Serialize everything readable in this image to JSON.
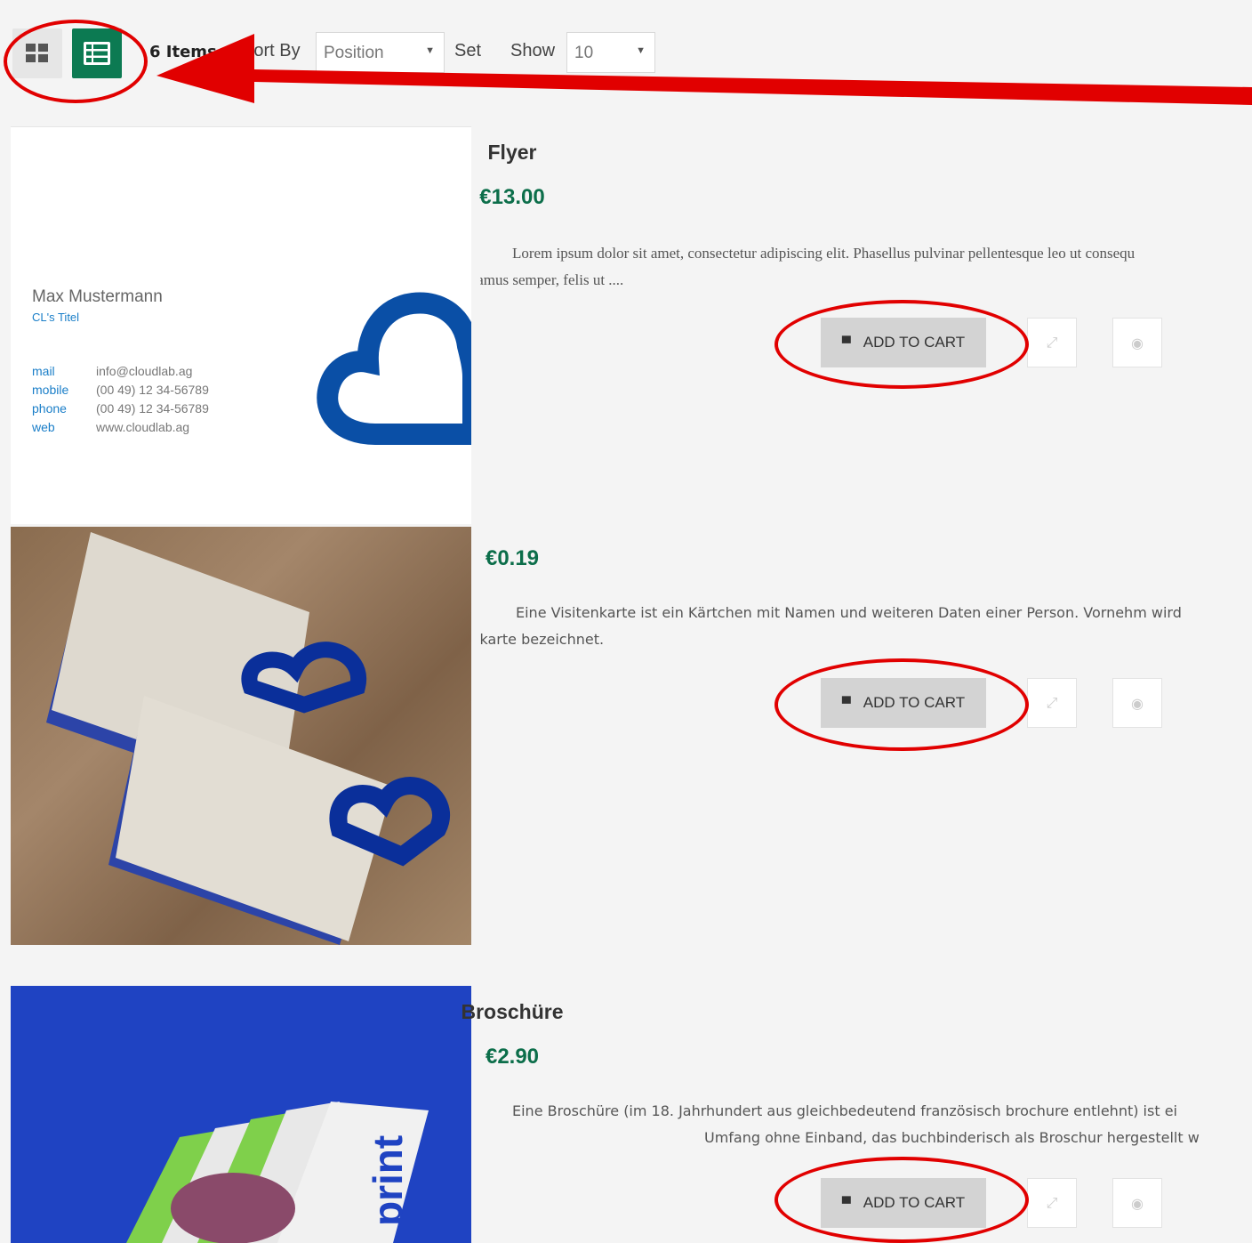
{
  "toolbar": {
    "item_count": "6 Items",
    "sort_label": "Sort By",
    "sort_value": "Position",
    "set_label": "Set",
    "show_label": "Show",
    "show_value": "10"
  },
  "products": [
    {
      "name": "Flyer",
      "price": "€13.00",
      "description_line1": "Lorem ipsum dolor sit amet, consectetur adipiscing elit. Phasellus pulvinar pellentesque leo ut consequ",
      "description_line2": "pretium. Vivamus semper, felis ut ....",
      "add_to_cart": "ADD TO CART"
    },
    {
      "name": "",
      "price": "€0.19",
      "description_line1": "Eine Visitenkarte ist ein Kärtchen mit Namen und weiteren Daten einer Person. Vornehm wird",
      "description_line2": "Besuchskarte bezeichnet.",
      "add_to_cart": "ADD TO CART"
    },
    {
      "name": "Broschüre",
      "price": "€2.90",
      "description_line1": "Eine Broschüre (im 18. Jahrhundert aus gleichbedeutend französisch brochure entlehnt) ist ei",
      "description_line2": "Umfang ohne Einband, das buchbinderisch als Broschur hergestellt w",
      "add_to_cart": "ADD TO CART"
    }
  ],
  "business_card": {
    "name": "Max Mustermann",
    "title": "CL's Titel",
    "rows": [
      {
        "label": "mail",
        "value": "info@cloudlab.ag"
      },
      {
        "label": "mobile",
        "value": "(00 49) 12 34-56789"
      },
      {
        "label": "phone",
        "value": "(00 49) 12 34-56789"
      },
      {
        "label": "web",
        "value": "www.cloudlab.ag"
      }
    ]
  },
  "colors": {
    "accent": "#0c7a52",
    "price": "#0c6e4a",
    "annotation": "#e10000",
    "cloud": "#0a4fa6"
  }
}
